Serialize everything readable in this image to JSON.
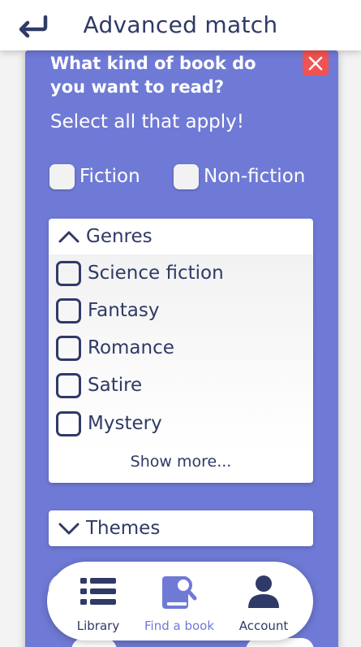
{
  "header": {
    "title": "Advanced match",
    "back_icon": "back-arrow-icon"
  },
  "question": {
    "title": "What kind of book do you want to read?",
    "subtitle": "Select all that apply!"
  },
  "book_types": [
    {
      "label": "Fiction",
      "checked": false
    },
    {
      "label": "Non-fiction",
      "checked": false
    }
  ],
  "genres": {
    "title": "Genres",
    "expanded": true,
    "items": [
      {
        "label": "Science fiction",
        "checked": false
      },
      {
        "label": "Fantasy",
        "checked": false
      },
      {
        "label": "Romance",
        "checked": false
      },
      {
        "label": "Satire",
        "checked": false
      },
      {
        "label": "Mystery",
        "checked": false
      }
    ],
    "show_more": "Show more..."
  },
  "themes": {
    "title": "Themes",
    "expanded": false
  },
  "nav": {
    "items": [
      {
        "label": "Library",
        "icon": "list-icon",
        "active": false
      },
      {
        "label": "Find a book",
        "icon": "book-search-icon",
        "active": true
      },
      {
        "label": "Account",
        "icon": "user-icon",
        "active": false
      }
    ]
  },
  "colors": {
    "panel": "#6f7ad6",
    "text_dark": "#2f3a66",
    "close": "#f05353",
    "active_nav": "#6f7ad6"
  }
}
